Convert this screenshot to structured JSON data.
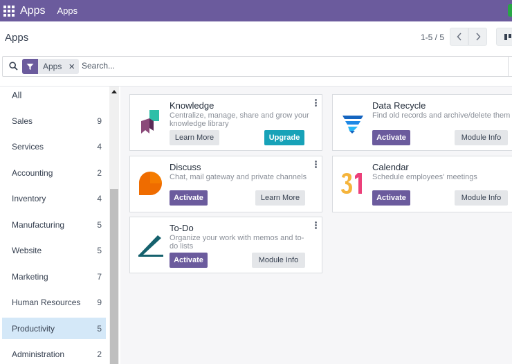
{
  "navbar": {
    "brand": "Apps",
    "menu_item": "Apps",
    "apps_icon": "grid-icon"
  },
  "control": {
    "title": "Apps",
    "pager": {
      "value": "1-5 / 5",
      "prev_icon": "chevron-left-icon",
      "next_icon": "chevron-right-icon"
    },
    "view_icon": "kanban-view-icon"
  },
  "search": {
    "icon": "search-icon",
    "facet": {
      "icon": "filter-icon",
      "label": "Apps",
      "close_label": "×"
    },
    "placeholder": "Search..."
  },
  "sidebar": {
    "items": [
      {
        "label": "All",
        "count": ""
      },
      {
        "label": "Sales",
        "count": "9"
      },
      {
        "label": "Services",
        "count": "4"
      },
      {
        "label": "Accounting",
        "count": "2"
      },
      {
        "label": "Inventory",
        "count": "4"
      },
      {
        "label": "Manufacturing",
        "count": "5"
      },
      {
        "label": "Website",
        "count": "5"
      },
      {
        "label": "Marketing",
        "count": "7"
      },
      {
        "label": "Human Resources",
        "count": "9"
      },
      {
        "label": "Productivity",
        "count": "5"
      },
      {
        "label": "Administration",
        "count": "2"
      }
    ],
    "active_item": "Productivity"
  },
  "apps": [
    {
      "name": "Knowledge",
      "description": "Centralize, manage, share and grow your knowledge library",
      "icon": "knowledge-icon",
      "buttons": [
        {
          "label": "Learn More",
          "style": "secondary"
        },
        {
          "label": "Upgrade",
          "style": "upgrade"
        }
      ]
    },
    {
      "name": "Data Recycle",
      "description": "Find old records and archive/delete them",
      "icon": "data-recycle-icon",
      "buttons": [
        {
          "label": "Activate",
          "style": "primary"
        },
        {
          "label": "Module Info",
          "style": "secondary"
        }
      ]
    },
    {
      "name": "Discuss",
      "description": "Chat, mail gateway and private channels",
      "icon": "discuss-icon",
      "buttons": [
        {
          "label": "Activate",
          "style": "primary"
        },
        {
          "label": "Learn More",
          "style": "secondary"
        }
      ]
    },
    {
      "name": "Calendar",
      "description": "Schedule employees' meetings",
      "icon": "calendar-icon",
      "buttons": [
        {
          "label": "Activate",
          "style": "primary"
        },
        {
          "label": "Module Info",
          "style": "secondary"
        }
      ]
    },
    {
      "name": "To-Do",
      "description": "Organize your work with memos and to-do lists",
      "icon": "todo-icon",
      "buttons": [
        {
          "label": "Activate",
          "style": "primary"
        },
        {
          "label": "Module Info",
          "style": "secondary"
        }
      ]
    }
  ],
  "colors": {
    "navbar": "#6b5b9d",
    "primary": "#6b5b9d",
    "upgrade": "#17a2b8",
    "active_filter": "#d4e8f8"
  }
}
